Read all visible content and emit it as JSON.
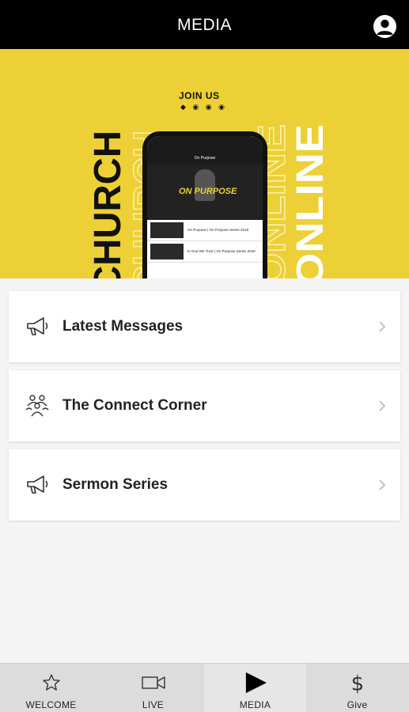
{
  "header": {
    "title": "MEDIA",
    "profile_icon": "profile-icon"
  },
  "banner": {
    "word_left": "CHURCH",
    "word_right": "ONLINE",
    "join_text": "JOIN US",
    "phone": {
      "app_title": "On Purpose",
      "hero_title": "ON PURPOSE",
      "items": [
        {
          "text": "On Purpose | On Purpose Series 2018"
        },
        {
          "text": "In God We Trust | On Purpose Series 2018"
        }
      ]
    },
    "background_color": "#ecd035"
  },
  "menu": {
    "items": [
      {
        "label": "Latest Messages",
        "icon": "megaphone-icon"
      },
      {
        "label": "The Connect Corner",
        "icon": "group-icon"
      },
      {
        "label": "Sermon Series",
        "icon": "megaphone-icon"
      }
    ]
  },
  "tabs": [
    {
      "label": "WELCOME",
      "icon": "star-icon",
      "active": false
    },
    {
      "label": "LIVE",
      "icon": "video-camera-icon",
      "active": false
    },
    {
      "label": "MEDIA",
      "icon": "play-icon",
      "active": true
    },
    {
      "label": "Give",
      "icon": "dollar-icon",
      "active": false
    }
  ]
}
